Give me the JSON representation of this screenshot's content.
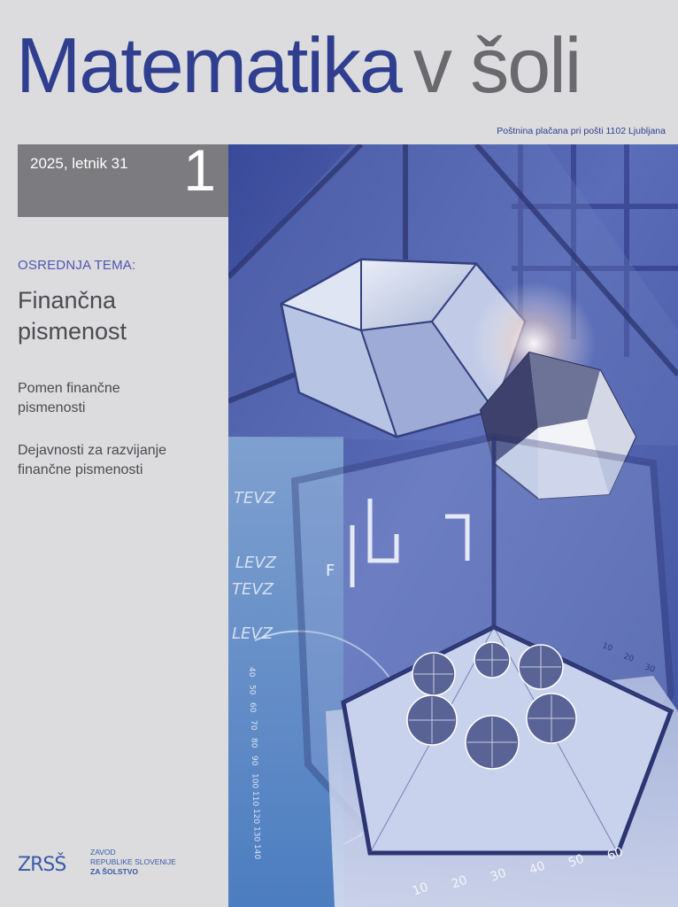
{
  "masthead": {
    "title_part1": "Matematika",
    "title_part2": "v šoli",
    "postal_notice": "Poštnina plačana pri pošti 1102 Ljubljana"
  },
  "issue": {
    "year_volume": "2025, letnik 31",
    "number": "1"
  },
  "focus": {
    "label": "OSREDNJA TEMA:",
    "title_line1": "Finančna",
    "title_line2": "pismenost"
  },
  "articles": [
    {
      "line1": "Pomen finančne",
      "line2": "pismenosti"
    },
    {
      "line1": "Dejavnosti za razvijanje",
      "line2": "finančne pismenosti"
    }
  ],
  "cover_photo": {
    "letters_row1": "TEVZ",
    "letters_row2": "LEVZ",
    "letters_row3": "TEVZ",
    "letters_row4": "LEVZ",
    "grid_letter": "F",
    "scale_left": [
      "40",
      "50",
      "60",
      "70",
      "80",
      "90",
      "100",
      "110",
      "120",
      "130",
      "140"
    ],
    "scale_bottom": [
      "10",
      "20",
      "30",
      "40",
      "50",
      "60"
    ],
    "scale_right": [
      "30",
      "20",
      "10"
    ]
  },
  "publisher": {
    "logo_text": "ZRSŠ",
    "line1": "ZAVOD",
    "line2": "REPUBLIKE SLOVENIJE",
    "line3": "ZA ŠOLSTVO"
  },
  "colors": {
    "brand_blue": "#2f3e8e",
    "accent_purple": "#5254b2",
    "issue_box_gray": "#7c7c80",
    "background": "#dcdcde"
  }
}
